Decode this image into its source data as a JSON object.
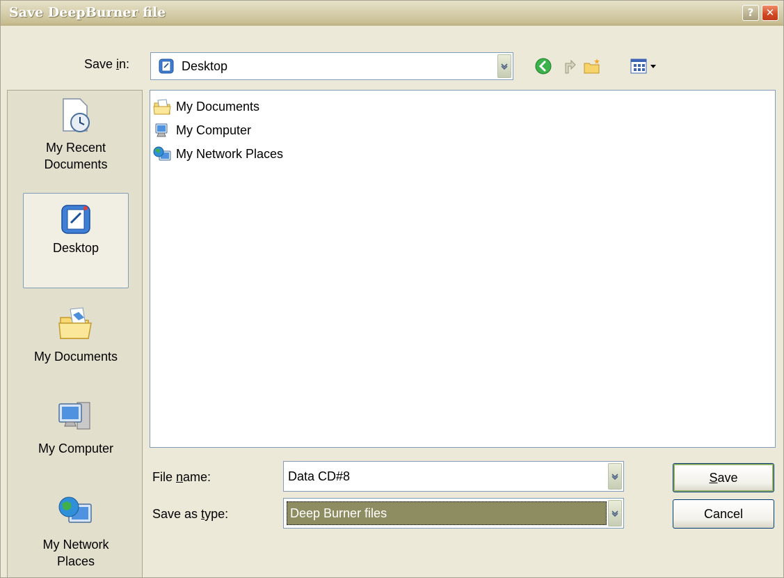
{
  "window": {
    "title": "Save DeepBurner file",
    "help_label": "?",
    "close_label": "✕"
  },
  "save_in": {
    "label_prefix": "Save ",
    "label_access": "i",
    "label_suffix": "n:",
    "value": "Desktop"
  },
  "places": [
    {
      "label": "My Recent Documents",
      "icon": "recent-documents-icon"
    },
    {
      "label": "Desktop",
      "icon": "desktop-icon",
      "selected": true
    },
    {
      "label": "My Documents",
      "icon": "my-documents-folder-icon"
    },
    {
      "label": "My Computer",
      "icon": "my-computer-icon"
    },
    {
      "label": "My Network Places",
      "icon": "network-places-icon"
    }
  ],
  "files": [
    {
      "label": "My Documents",
      "icon": "my-documents-icon"
    },
    {
      "label": "My Computer",
      "icon": "my-computer-icon"
    },
    {
      "label": "My Network Places",
      "icon": "network-places-icon"
    }
  ],
  "file_name": {
    "label_prefix": "File ",
    "label_access": "n",
    "label_suffix": "ame:",
    "value": "Data CD#8"
  },
  "save_as_type": {
    "label_prefix": "Save as ",
    "label_access": "t",
    "label_suffix": "ype:",
    "value": "Deep Burner files"
  },
  "buttons": {
    "save_access": "S",
    "save_rest": "ave",
    "cancel": "Cancel"
  },
  "colors": {
    "selection": "#8e8d62",
    "border": "#7f9db9",
    "dialog_bg": "#ece9d8"
  }
}
